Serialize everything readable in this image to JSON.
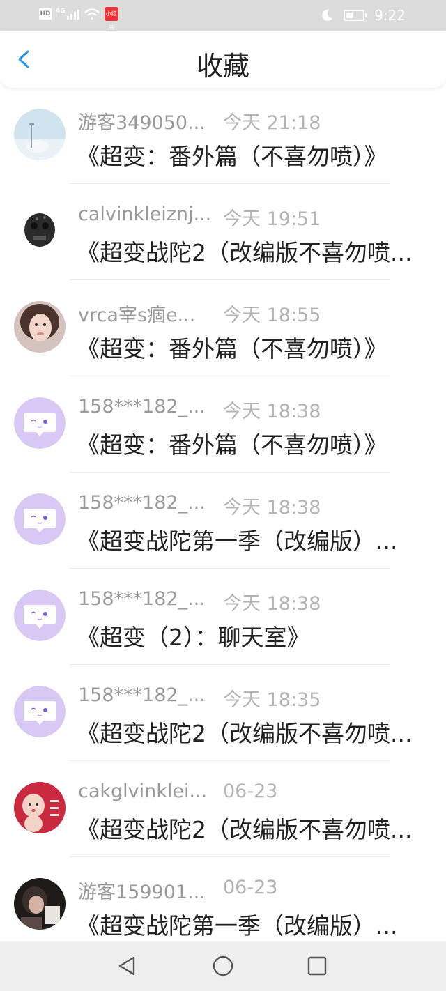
{
  "status_bar": {
    "network": "4G",
    "app_badge": "小红书",
    "time": "9:22"
  },
  "header": {
    "title": "收藏"
  },
  "items": [
    {
      "name": "游客349050...",
      "time": "今天 21:18",
      "subject": "《超变：番外篇（不喜勿喷）》",
      "avatar": "landscape-photo"
    },
    {
      "name": "calvinkleiznj...",
      "time": "今天 19:51",
      "subject": "《超变战陀2（改编版不喜勿喷...",
      "avatar": "dark-skull-ring"
    },
    {
      "name": "vrca宰s痼e...",
      "time": "今天 18:55",
      "subject": "《超变：番外篇（不喜勿喷）》",
      "avatar": "woman-portrait"
    },
    {
      "name": "158***182_...",
      "time": "今天 18:38",
      "subject": "《超变：番外篇（不喜勿喷）》",
      "avatar": "speech-bubble-default"
    },
    {
      "name": "158***182_...",
      "time": "今天 18:38",
      "subject": "《超变战陀第一季（改编版）...",
      "avatar": "speech-bubble-default"
    },
    {
      "name": "158***182_...",
      "time": "今天 18:38",
      "subject": "《超变（2）：聊天室》",
      "avatar": "speech-bubble-default"
    },
    {
      "name": "158***182_...",
      "time": "今天 18:35",
      "subject": "《超变战陀2（改编版不喜勿喷...",
      "avatar": "speech-bubble-default"
    },
    {
      "name": "cakglvinklei...",
      "time": "06-23",
      "subject": "《超变战陀2（改编版不喜勿喷...",
      "avatar": "baby-cartoon-red"
    },
    {
      "name": "游客159901...",
      "time": "06-23",
      "subject": "《超变战陀第一季（改编版）...",
      "avatar": "dark-person-photo"
    }
  ],
  "colors": {
    "accent": "#2196f3",
    "bubble_bg": "#d9c8f3",
    "bubble_fg": "#7c5ccf"
  }
}
